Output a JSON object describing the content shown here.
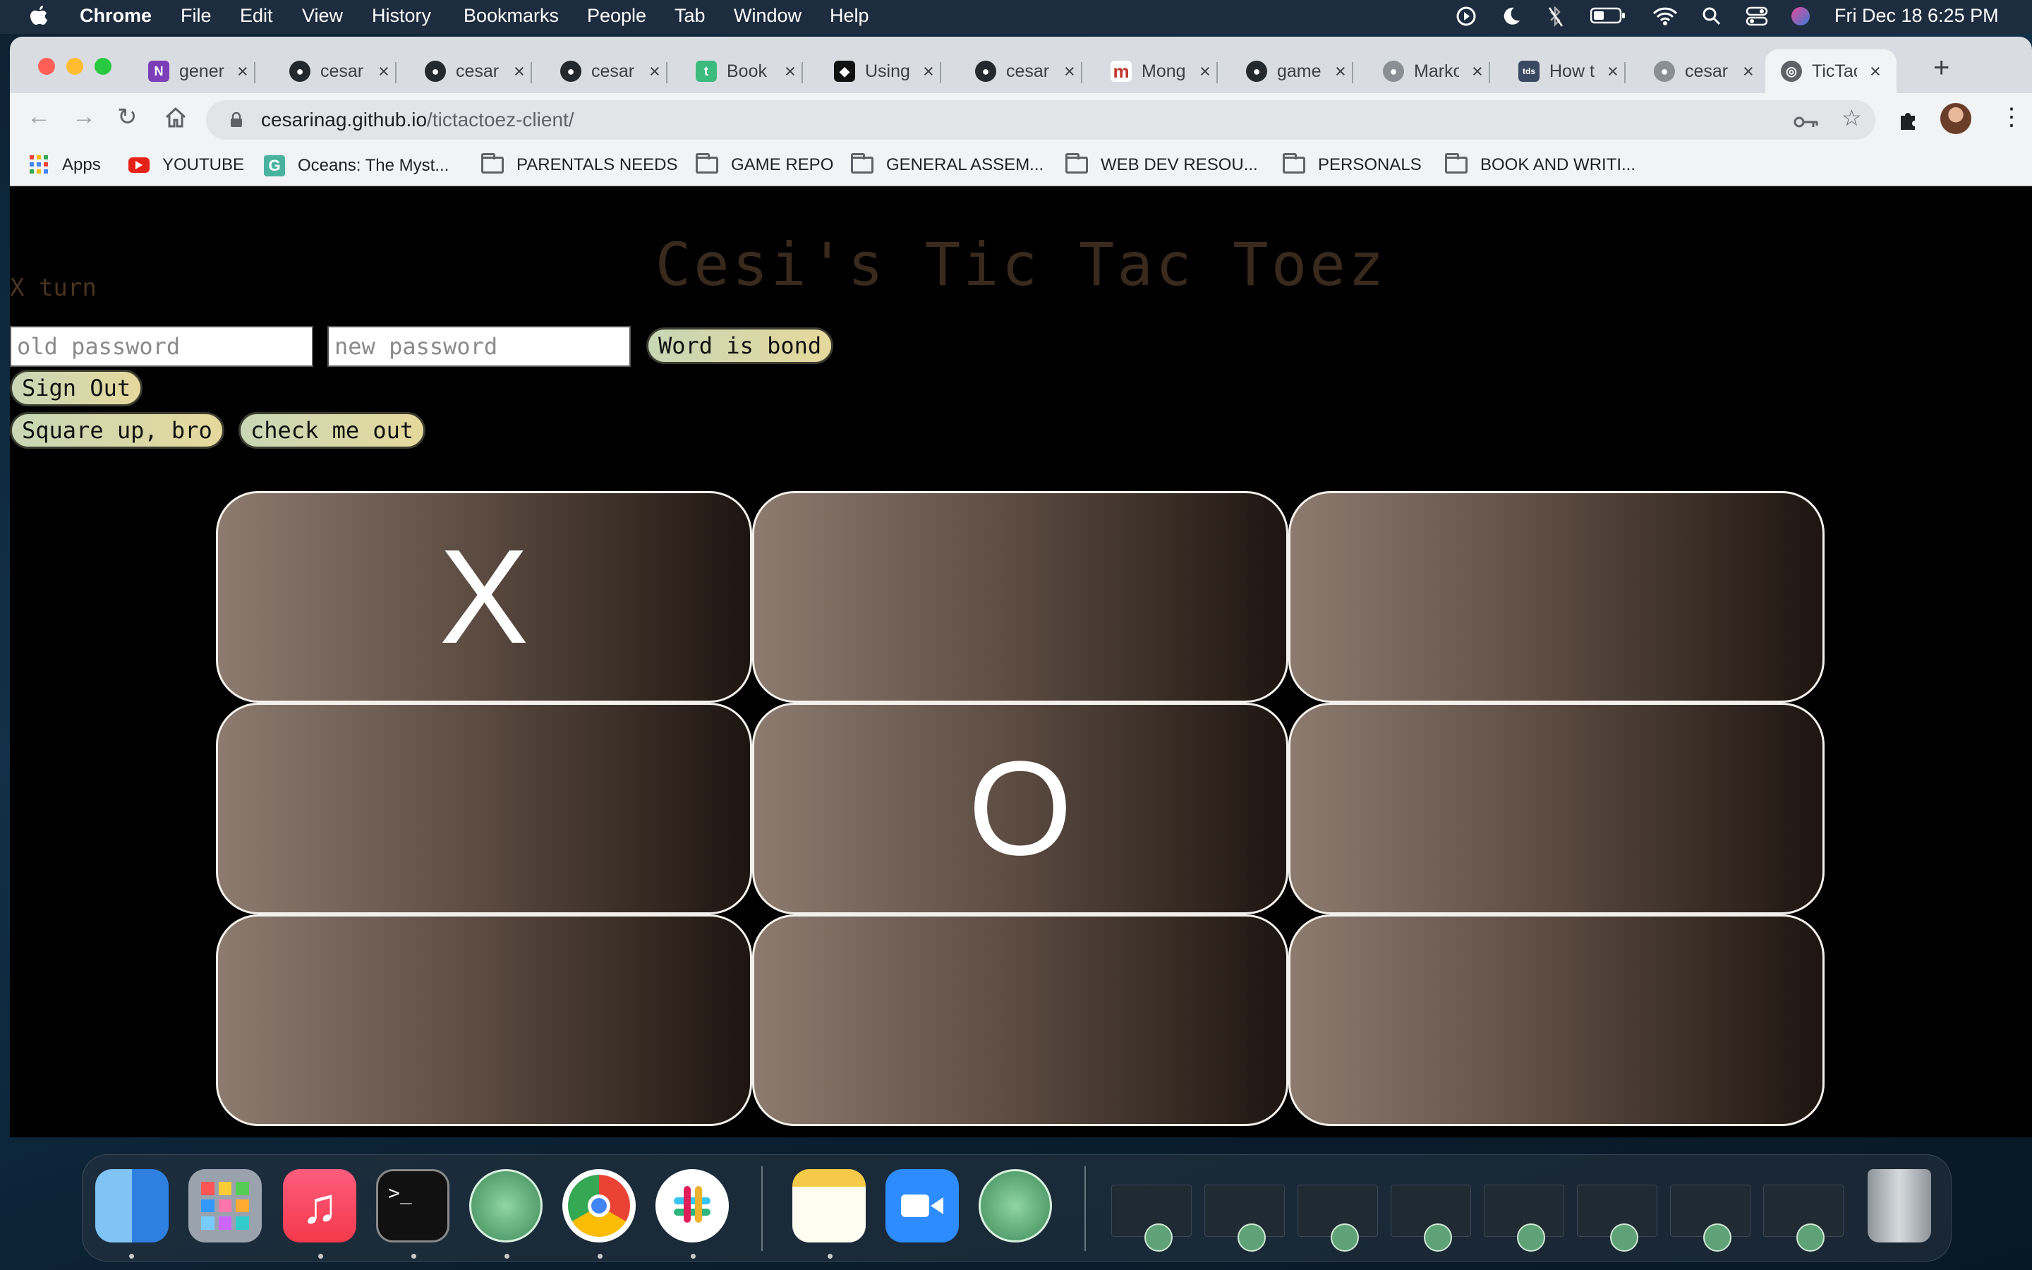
{
  "menubar": {
    "app_name": "Chrome",
    "menus": [
      "File",
      "Edit",
      "View",
      "History",
      "Bookmarks",
      "People",
      "Tab",
      "Window",
      "Help"
    ],
    "clock": "Fri Dec 18  6:25 PM"
  },
  "tabs": [
    {
      "title": "gener",
      "icon": "onenote-icon",
      "color": "#7b3fb8",
      "glyph": "N"
    },
    {
      "title": "cesar",
      "icon": "github-icon",
      "color": "#24292e",
      "glyph": "●"
    },
    {
      "title": "cesar",
      "icon": "github-icon",
      "color": "#24292e",
      "glyph": "●"
    },
    {
      "title": "cesar",
      "icon": "github-icon",
      "color": "#24292e",
      "glyph": "●"
    },
    {
      "title": "Book",
      "icon": "book-icon",
      "color": "#3dba7e",
      "glyph": "t"
    },
    {
      "title": "Using",
      "icon": "codepen-icon",
      "color": "#111111",
      "glyph": "◆"
    },
    {
      "title": "cesar",
      "icon": "github-icon",
      "color": "#24292e",
      "glyph": "●"
    },
    {
      "title": "Mong",
      "icon": "mongo-icon",
      "color": "#ffffff",
      "glyph": "m"
    },
    {
      "title": "game",
      "icon": "github-icon",
      "color": "#24292e",
      "glyph": "●"
    },
    {
      "title": "Marko",
      "icon": "github-icon",
      "color": "#8a8f94",
      "glyph": "●"
    },
    {
      "title": "How t",
      "icon": "tds-icon",
      "color": "#3b4a63",
      "glyph": "tds"
    },
    {
      "title": "cesar",
      "icon": "github-icon",
      "color": "#8a8f94",
      "glyph": "●"
    },
    {
      "title": "TicTac",
      "icon": "globe-icon",
      "color": "#5f6368",
      "glyph": "◎",
      "active": true
    }
  ],
  "omnibox": {
    "host": "cesarinag.github.io",
    "path": "/tictactoez-client/"
  },
  "bookmarks": [
    {
      "label": "Apps",
      "icon": "apps-grid-icon"
    },
    {
      "label": "YOUTUBE",
      "icon": "youtube-icon"
    },
    {
      "label": "Oceans: The Myst...",
      "icon": "g-icon"
    },
    {
      "label": "PARENTALS NEEDS",
      "icon": "folder-icon"
    },
    {
      "label": "GAME REPO",
      "icon": "folder-icon"
    },
    {
      "label": "GENERAL ASSEM...",
      "icon": "folder-icon"
    },
    {
      "label": "WEB DEV RESOU...",
      "icon": "folder-icon"
    },
    {
      "label": "PERSONALS",
      "icon": "folder-icon"
    },
    {
      "label": "BOOK AND WRITI...",
      "icon": "folder-icon"
    }
  ],
  "game": {
    "title": "Cesi's Tic Tac Toez",
    "turn": "X turn",
    "old_password_placeholder": "old password",
    "new_password_placeholder": "new password",
    "change_password_button": "Word is bond",
    "sign_out_button": "Sign Out",
    "new_game_button": "Square up, bro",
    "stats_button": "check me out",
    "board": [
      "X",
      "",
      "",
      "",
      "O",
      "",
      "",
      "",
      ""
    ]
  },
  "dock": {
    "apps": [
      "finder-icon",
      "launchpad-icon",
      "music-icon",
      "terminal-icon",
      "atom-icon",
      "chrome-icon",
      "slack-icon",
      "notes-icon",
      "zoom-icon",
      "atom-icon"
    ],
    "minimized_windows": 8
  }
}
